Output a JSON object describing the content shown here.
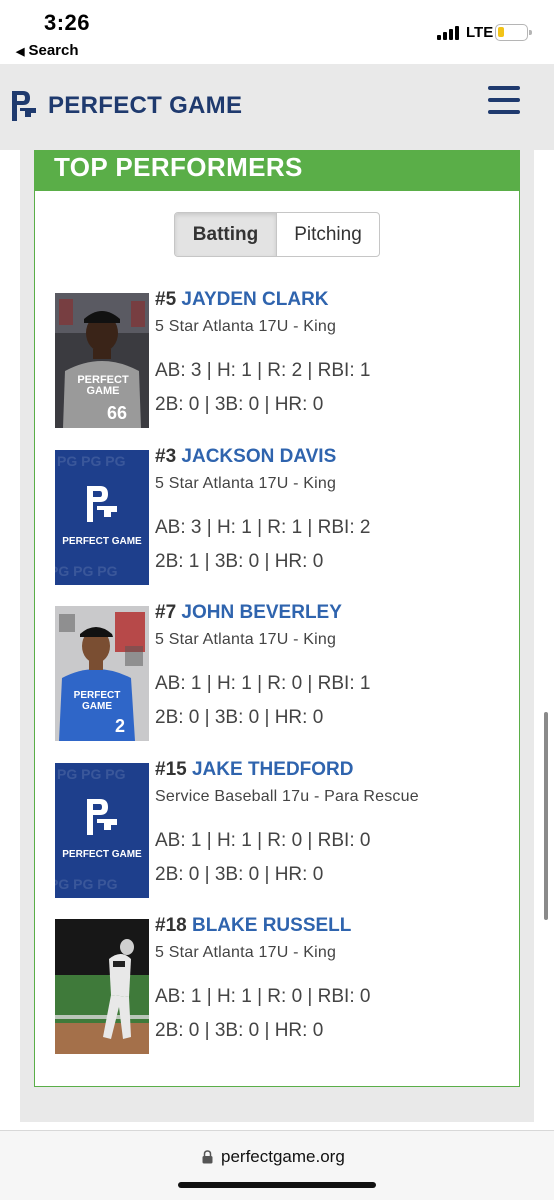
{
  "status_bar": {
    "time": "3:26",
    "back_label": "Search",
    "network": "LTE",
    "battery_color": "#f2c318"
  },
  "header": {
    "brand": "PERFECT GAME",
    "logo_icon": "pg-logo-icon",
    "menu_icon": "hamburger-menu-icon",
    "brand_color": "#1f3a6e"
  },
  "section": {
    "title": "TOP PERFORMERS",
    "accent_color": "#5aae48",
    "tabs": [
      {
        "label": "Batting",
        "selected": true
      },
      {
        "label": "Pitching",
        "selected": false
      }
    ]
  },
  "players": [
    {
      "number": "#5",
      "name": "JAYDEN CLARK",
      "team": "5 Star Atlanta 17U - King",
      "stats_line1": "AB: 3 | H: 1 | R: 2 | RBI: 1",
      "stats_line2": "2B: 0 | 3B: 0 | HR: 0",
      "photo": "player-photo",
      "jersey_text": "PERFECT GAME",
      "jersey_number": "66"
    },
    {
      "number": "#3",
      "name": "JACKSON DAVIS",
      "team": "5 Star Atlanta 17U - King",
      "stats_line1": "AB: 3 | H: 1 | R: 1 | RBI: 2",
      "stats_line2": "2B: 1 | 3B: 0 | HR: 0",
      "photo": "pg-placeholder",
      "placeholder_text": "PERFECT GAME"
    },
    {
      "number": "#7",
      "name": "JOHN BEVERLEY",
      "team": "5 Star Atlanta 17U - King",
      "stats_line1": "AB: 1 | H: 1 | R: 0 | RBI: 1",
      "stats_line2": "2B: 0 | 3B: 0 | HR: 0",
      "photo": "player-photo",
      "jersey_text": "PERFECT GAME",
      "jersey_number": "2"
    },
    {
      "number": "#15",
      "name": "JAKE THEDFORD",
      "team": "Service Baseball 17u - Para Rescue",
      "stats_line1": "AB: 1 | H: 1 | R: 0 | RBI: 0",
      "stats_line2": "2B: 0 | 3B: 0 | HR: 0",
      "photo": "pg-placeholder",
      "placeholder_text": "PERFECT GAME"
    },
    {
      "number": "#18",
      "name": "BLAKE RUSSELL",
      "team": "5 Star Atlanta 17U - King",
      "stats_line1": "AB: 1 | H: 1 | R: 0 | RBI: 0",
      "stats_line2": "2B: 0 | 3B: 0 | HR: 0",
      "photo": "action-photo"
    }
  ],
  "browser": {
    "url": "perfectgame.org",
    "lock_icon": "lock-icon"
  }
}
